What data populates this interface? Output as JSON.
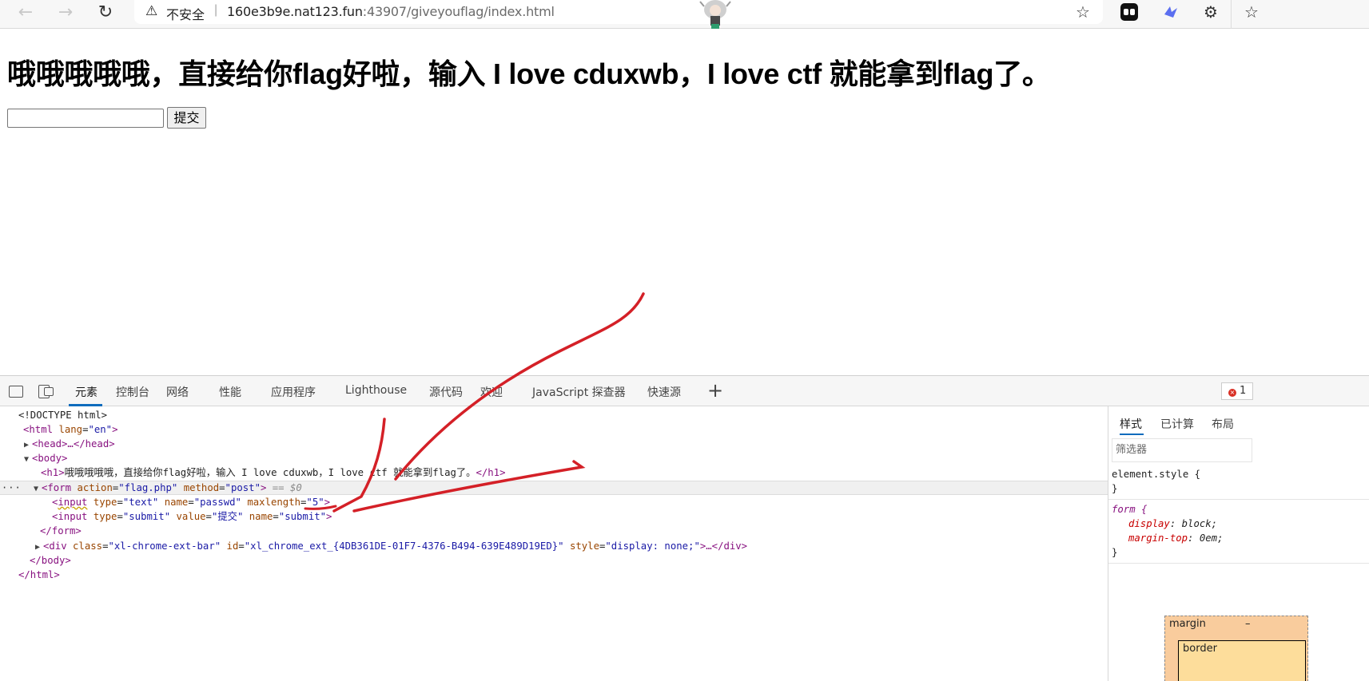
{
  "browser": {
    "back_icon": "←",
    "forward_icon": "→",
    "reload_icon": "↻",
    "warning_icon": "⚠",
    "security_label": "不安全",
    "url_host": "160e3b9e.nat123.fun",
    "url_path": ":43907/giveyouflag/index.html",
    "add_favorite_icon": "☆",
    "favorites_icon": "☆",
    "extensions_icon": "⚙"
  },
  "page": {
    "heading": "哦哦哦哦哦，直接给你flag好啦，输入 I love cduxwb，I love ctf 就能拿到flag了。",
    "input_value": "",
    "submit_label": "提交"
  },
  "devtools": {
    "tabs": [
      "元素",
      "控制台",
      "网络",
      "性能",
      "应用程序",
      "Lighthouse",
      "源代码",
      "欢迎",
      "JavaScript 探查器",
      "快速源"
    ],
    "add_tab": "+",
    "error_count": "1",
    "elements": {
      "doctype": "<!DOCTYPE html>",
      "html_tag": "html",
      "html_attr_name": "lang",
      "html_attr_value": "\"en\"",
      "head": "<head>…</head>",
      "body_open": "<body>",
      "h1_open": "<h1>",
      "h1_text": "哦哦哦哦哦，直接给你flag好啦，输入 I love cduxwb，I love ctf 就能拿到flag了。",
      "h1_close": "</h1>",
      "dots": "···",
      "form_tag": "form",
      "form_action_name": "action",
      "form_action_value": "\"flag.php\"",
      "form_method_name": "method",
      "form_method_value": "\"post\"",
      "selected_marker": "== $0",
      "input1_tag": "input",
      "input1_type_name": "type",
      "input1_type_value": "\"text\"",
      "input1_name_name": "name",
      "input1_name_value": "\"passwd\"",
      "input1_maxlength_name": "maxlength",
      "input1_maxlength_value": "\"5\"",
      "input2_tag": "input",
      "input2_type_name": "type",
      "input2_type_value": "\"submit\"",
      "input2_value_name": "value",
      "input2_value_value": "\"提交\"",
      "input2_name_name": "name",
      "input2_name_value": "\"submit\"",
      "form_close": "</form>",
      "div_tag": "div",
      "div_class_name": "class",
      "div_class_value": "\"xl-chrome-ext-bar\"",
      "div_id_name": "id",
      "div_id_value": "\"xl_chrome_ext_{4DB361DE-01F7-4376-B494-639E489D19ED}\"",
      "div_style_name": "style",
      "div_style_value": "\"display: none;\"",
      "div_close": ">…</div>",
      "body_close": "</body>",
      "html_close": "</html>"
    },
    "styles": {
      "tabs": [
        "样式",
        "已计算",
        "布局"
      ],
      "filter_placeholder": "筛选器",
      "element_style": "element.style {",
      "close_brace": "}",
      "form_selector": "form {",
      "display_prop": "display",
      "display_val": "block;",
      "margin_prop": "margin-top",
      "margin_val": "0em;",
      "box_margin_label": "margin",
      "box_margin_value": "–",
      "box_border_label": "border"
    }
  },
  "annotation": {
    "color": "#d42027"
  }
}
